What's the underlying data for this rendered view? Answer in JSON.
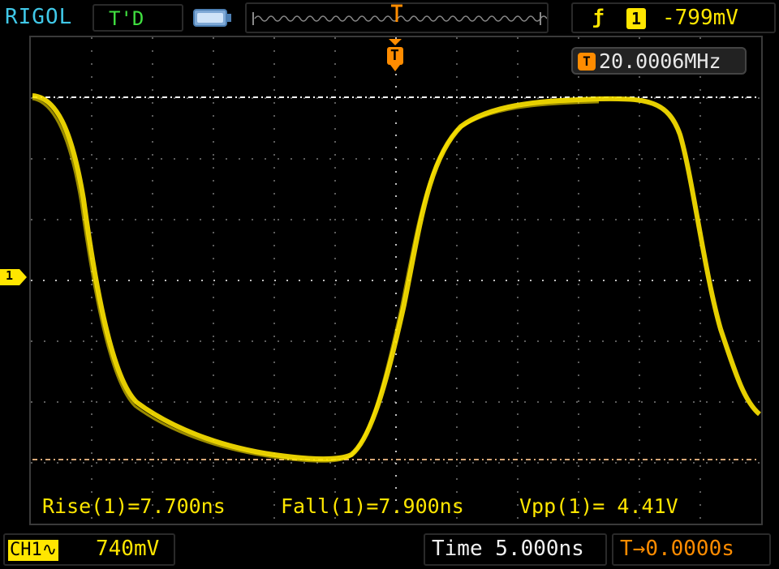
{
  "header": {
    "brand": "RIGOL",
    "status": "T'D",
    "trigger_edge": "ƒ",
    "trigger_channel": "1",
    "trigger_level": "-799mV"
  },
  "display": {
    "frequency_icon": "T",
    "frequency": "20.0006MHz",
    "channel_marker": "1",
    "trigger_marker": "T"
  },
  "measurements": {
    "rise": "Rise(1)=7.700ns",
    "fall": "Fall(1)=7.900ns",
    "vpp": "Vpp(1)= 4.41V"
  },
  "footer": {
    "channel_label": "CH1∿",
    "volts_per_div": "740mV",
    "timebase": "Time 5.000ns",
    "offset_icon": "T→",
    "offset": "0.0000s"
  },
  "colors": {
    "ch1": "#ffe600",
    "trigger": "#ff8c00",
    "brand": "#40c8e8",
    "status": "#40e040"
  }
}
